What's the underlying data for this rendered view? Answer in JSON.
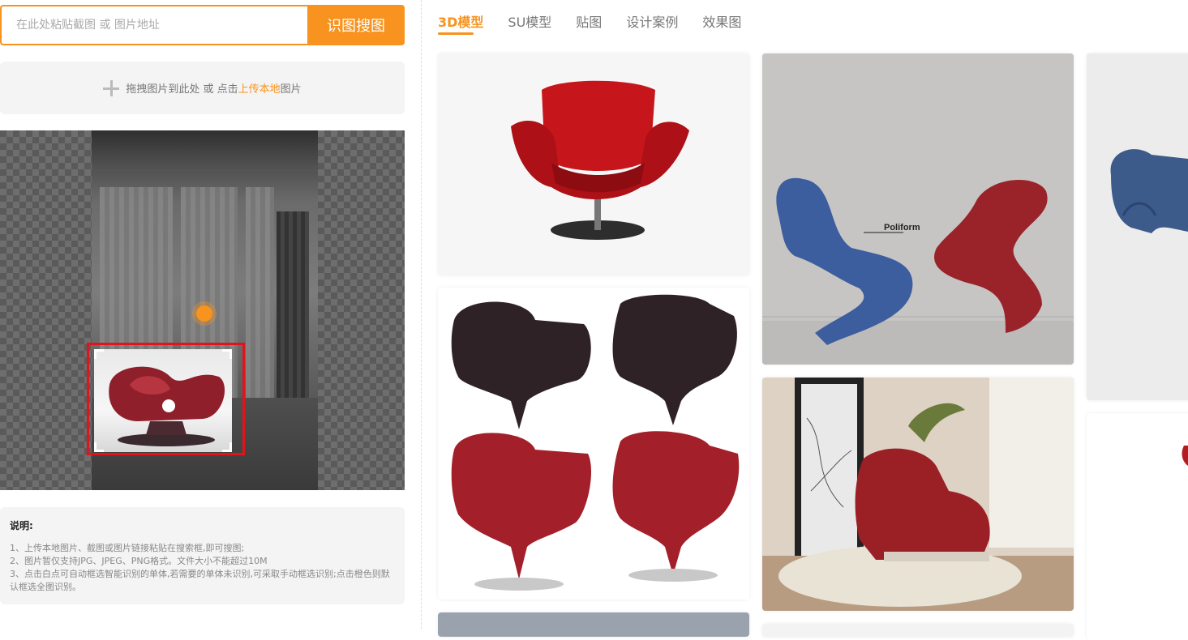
{
  "search": {
    "placeholder": "在此处粘贴截图 或 图片地址",
    "button_label": "识图搜图"
  },
  "upload": {
    "prefix": "拖拽图片到此处 或 点击",
    "link": "上传本地",
    "suffix": "图片"
  },
  "notes": {
    "title": "说明:",
    "lines": [
      "1、上传本地图片、截图或图片链接粘贴在搜索框,即可搜图;",
      "2、图片暂仅支持JPG、JPEG、PNG格式。文件大小不能超过10M",
      "3、点击白点可自动框选智能识别的单体,若需要的单体未识别,可采取手动框选识别;点击橙色则默认框选全图识别。"
    ]
  },
  "tabs": [
    {
      "label": "3D模型",
      "active": true
    },
    {
      "label": "SU模型",
      "active": false
    },
    {
      "label": "贴图",
      "active": false
    },
    {
      "label": "设计案例",
      "active": false
    },
    {
      "label": "效果图",
      "active": false
    }
  ],
  "results": {
    "poliform_label": "Poliform"
  },
  "colors": {
    "accent": "#f7931e",
    "selection_border": "#e1141c",
    "chair_red": "#b01e24",
    "chair_blue": "#3e5f9f"
  },
  "icons": [
    "plus-icon",
    "hotspot-orange-dot",
    "hotspot-white-dot"
  ]
}
